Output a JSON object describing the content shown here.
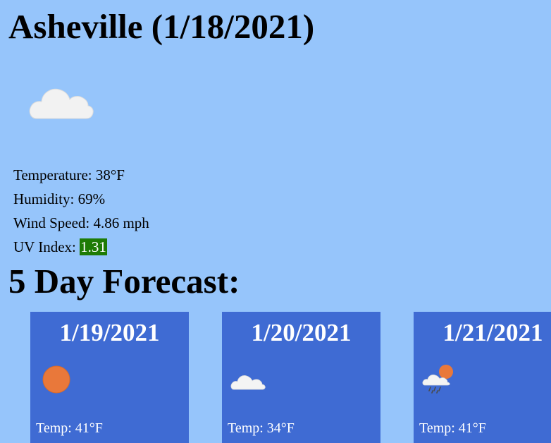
{
  "current": {
    "title": "Asheville (1/18/2021)",
    "icon": "cloud-icon",
    "temperature": "Temperature: 38°F",
    "humidity": "Humidity: 69%",
    "wind_speed": "Wind Speed: 4.86 mph",
    "uv_label": "UV Index: ",
    "uv_value": "1.31",
    "uv_color": "#1e7b05"
  },
  "forecast": {
    "title": "5 Day Forecast:",
    "card_color": "#3f6bd3",
    "days": [
      {
        "date": "1/19/2021",
        "icon": "sun-icon",
        "temp": "Temp: 41°F"
      },
      {
        "date": "1/20/2021",
        "icon": "cloud-icon",
        "temp": "Temp: 34°F"
      },
      {
        "date": "1/21/2021",
        "icon": "sun-cloud-rain-icon",
        "temp": "Temp: 41°F"
      }
    ]
  },
  "colors": {
    "background": "#96c5fb"
  }
}
